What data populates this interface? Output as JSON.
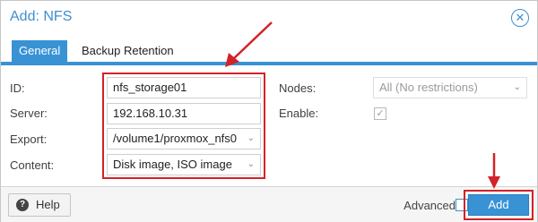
{
  "dialog": {
    "title": "Add: NFS",
    "close_icon": "close-icon"
  },
  "tabs": [
    {
      "label": "General",
      "active": true
    },
    {
      "label": "Backup Retention",
      "active": false
    }
  ],
  "form": {
    "id": {
      "label": "ID:",
      "value": "nfs_storage01"
    },
    "server": {
      "label": "Server:",
      "value": "192.168.10.31"
    },
    "export": {
      "label": "Export:",
      "value": "/volume1/proxmox_nfs0"
    },
    "content": {
      "label": "Content:",
      "value": "Disk image, ISO image"
    },
    "nodes": {
      "label": "Nodes:",
      "value": "All (No restrictions)"
    },
    "enable": {
      "label": "Enable:",
      "checked": true
    }
  },
  "footer": {
    "help_label": "Help",
    "advanced_label": "Advanced",
    "advanced_checked": false,
    "add_label": "Add"
  },
  "colors": {
    "accent": "#3892d4",
    "annotation": "#d32229"
  }
}
